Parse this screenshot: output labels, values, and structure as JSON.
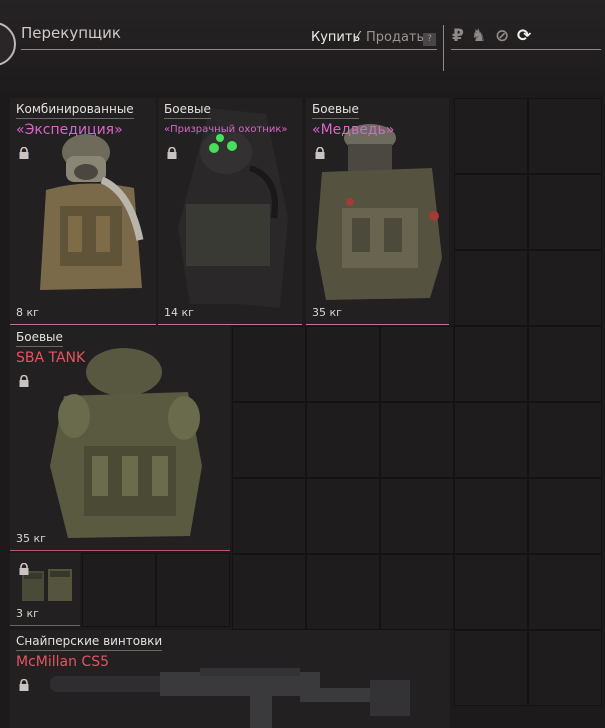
{
  "header": {
    "seller_title": "Перекупщик",
    "tab_buy": "Купить",
    "tab_separator": "⁄",
    "tab_sell": "Продать",
    "help": "?",
    "currencies": [
      {
        "icon": "ruble-icon",
        "glyph": "₽",
        "active": false
      },
      {
        "icon": "barter-icon",
        "glyph": "♞",
        "active": false
      },
      {
        "icon": "coin-icon",
        "glyph": "⊘",
        "active": false
      },
      {
        "icon": "refresh-icon",
        "glyph": "⟳",
        "active": true
      }
    ]
  },
  "items": [
    {
      "category": "Комбинированные",
      "name": "«Экспедиция»",
      "weight": "8 кг",
      "locked": true
    },
    {
      "category": "Боевые",
      "name": "«Призрачный охотник»",
      "weight": "14 кг",
      "locked": true
    },
    {
      "category": "Боевые",
      "name": "«Медведь»",
      "weight": "35 кг",
      "locked": true
    },
    {
      "category": "Боевые",
      "name": "SBA TANK",
      "weight": "35 кг",
      "locked": true
    },
    {
      "category": "",
      "name": "",
      "weight": "3 кг",
      "locked": true
    },
    {
      "category": "Снайперские винтовки",
      "name": "McMillan CS5",
      "weight": "",
      "locked": true
    }
  ],
  "colors": {
    "accent_pink": "#d966c8",
    "accent_red": "#e55460"
  }
}
